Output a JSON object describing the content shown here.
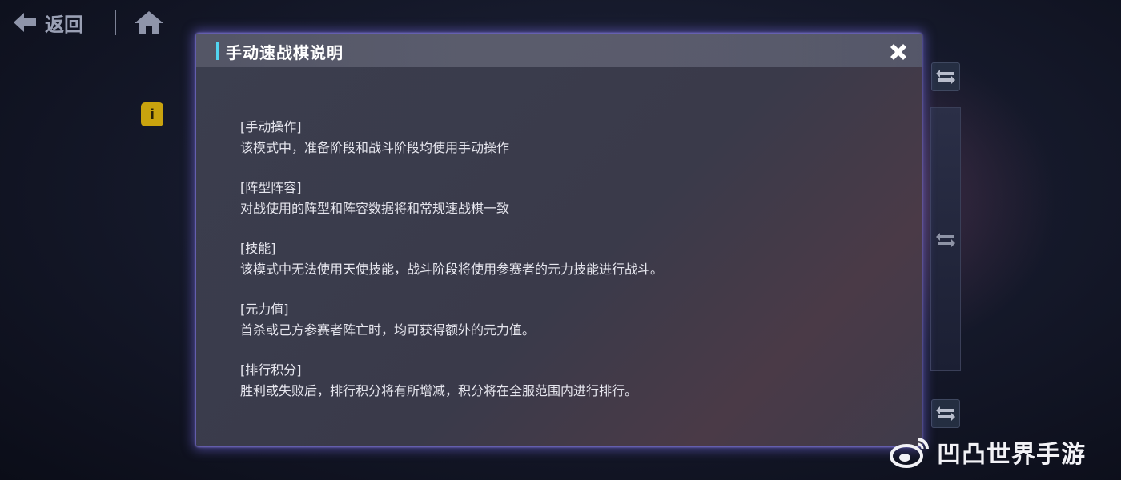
{
  "nav": {
    "back_label": "返回"
  },
  "modal": {
    "title": "手动速战棋说明",
    "sections": [
      {
        "heading": "[手动操作]",
        "text": "该模式中，准备阶段和战斗阶段均使用手动操作"
      },
      {
        "heading": "[阵型阵容]",
        "text": "对战使用的阵型和阵容数据将和常规速战棋一致"
      },
      {
        "heading": "[技能]",
        "text": "该模式中无法使用天使技能，战斗阶段将使用参赛者的元力技能进行战斗。"
      },
      {
        "heading": "[元力值]",
        "text": "首杀或己方参赛者阵亡时，均可获得额外的元力值。"
      },
      {
        "heading": "[排行积分]",
        "text": "胜利或失败后，排行积分将有所增减，积分将在全服范围内进行排行。"
      }
    ]
  },
  "background": {
    "info_badge": "i"
  },
  "watermark": {
    "text": "凹凸世界手游"
  },
  "colors": {
    "title_accent": "#52d4f0",
    "modal_glow": "#7a6ee6",
    "info_badge": "#c9a30e"
  },
  "icons": [
    "back-arrow-icon",
    "home-icon",
    "close-icon",
    "swap-arrows-icon",
    "info-icon",
    "weibo-icon"
  ]
}
